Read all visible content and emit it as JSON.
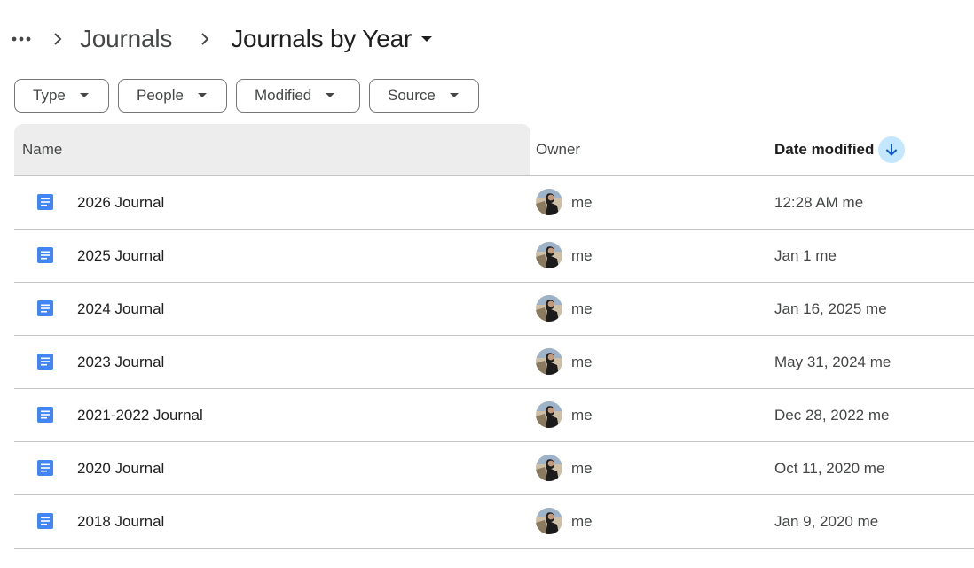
{
  "breadcrumb": {
    "more_icon": "more-horiz-icon",
    "parent": "Journals",
    "current": "Journals by Year"
  },
  "filters": [
    {
      "label": "Type"
    },
    {
      "label": "People"
    },
    {
      "label": "Modified"
    },
    {
      "label": "Source"
    }
  ],
  "table": {
    "headers": {
      "name": "Name",
      "owner": "Owner",
      "date_modified": "Date modified"
    },
    "sort": {
      "column": "date_modified",
      "direction": "descending",
      "icon": "arrow-downward-icon"
    },
    "rows": [
      {
        "name": "2026 Journal",
        "owner": "me",
        "modified": "12:28 AM me"
      },
      {
        "name": "2025 Journal",
        "owner": "me",
        "modified": "Jan 1 me"
      },
      {
        "name": "2024 Journal",
        "owner": "me",
        "modified": "Jan 16, 2025 me"
      },
      {
        "name": "2023 Journal",
        "owner": "me",
        "modified": "May 31, 2024 me"
      },
      {
        "name": "2021-2022 Journal",
        "owner": "me",
        "modified": "Dec 28, 2022 me"
      },
      {
        "name": "2020 Journal",
        "owner": "me",
        "modified": "Oct 11, 2020 me"
      },
      {
        "name": "2018 Journal",
        "owner": "me",
        "modified": "Jan 9, 2020 me"
      }
    ]
  },
  "colors": {
    "doc_icon": "#4285f4",
    "sort_badge": "#c2e7ff",
    "header_bg": "#ededed",
    "divider": "#c4c7c5"
  }
}
